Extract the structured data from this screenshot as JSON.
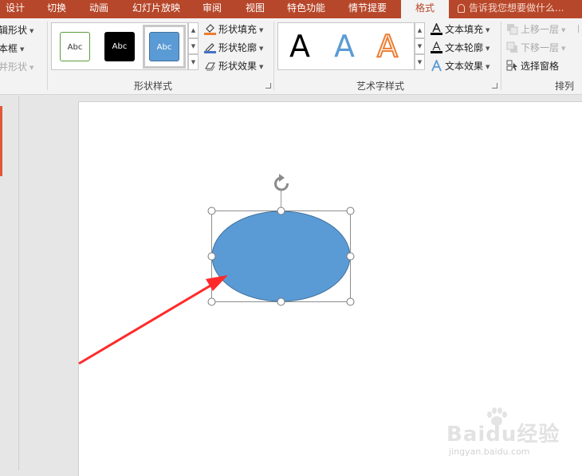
{
  "tabs": [
    {
      "label": "设计"
    },
    {
      "label": "切换"
    },
    {
      "label": "动画"
    },
    {
      "label": "幻灯片放映"
    },
    {
      "label": "审阅"
    },
    {
      "label": "视图"
    },
    {
      "label": "特色功能"
    },
    {
      "label": "情节提要"
    },
    {
      "label": "格式",
      "active": true
    }
  ],
  "tell_me": {
    "text": "告诉我您想要做什么..."
  },
  "insert_shapes": {
    "edit_shape": "辑形状",
    "text_box": "本框",
    "merge_shapes": "并形状"
  },
  "shape_styles": {
    "group_label": "形状样式",
    "gallery": [
      {
        "text": "Abc",
        "style": "outline-green"
      },
      {
        "text": "Abc",
        "style": "fill-black"
      },
      {
        "text": "Abc",
        "style": "fill-blue",
        "selected": true
      }
    ],
    "fill": "形状填充",
    "outline": "形状轮廓",
    "effects": "形状效果"
  },
  "wordart_styles": {
    "group_label": "艺术字样式",
    "gallery": [
      {
        "glyph": "A",
        "style": "black"
      },
      {
        "glyph": "A",
        "style": "blue"
      },
      {
        "glyph": "A",
        "style": "orange-outline"
      }
    ],
    "text_fill": "文本填充",
    "text_outline": "文本轮廓",
    "text_effects": "文本效果"
  },
  "arrange": {
    "group_label": "排列",
    "bring_forward": "上移一层",
    "send_backward": "下移一层",
    "selection_pane": "选择窗格"
  },
  "watermark": {
    "logo": "Baidu经验",
    "url": "jingyan.baidu.com"
  },
  "colors": {
    "accent_tab_bar": "#b7472a",
    "ellipse_fill": "#5b9bd5",
    "ellipse_stroke": "#41719c",
    "arrow": "#ff2a2a",
    "thumb_accent": "#e2573a"
  }
}
